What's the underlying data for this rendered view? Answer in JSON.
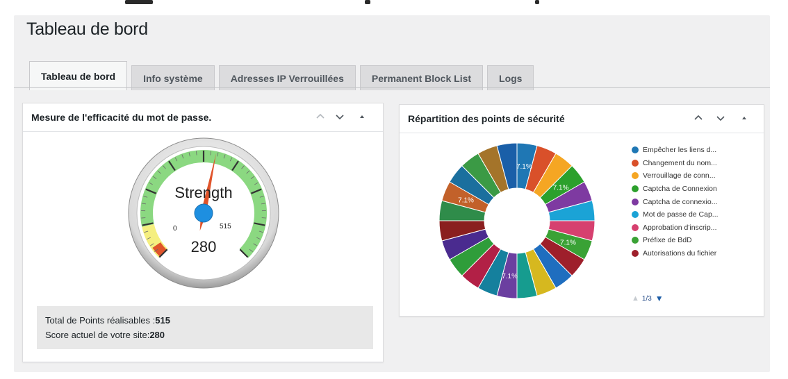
{
  "page": {
    "title": "Tableau de bord"
  },
  "tabs": [
    {
      "label": "Tableau de bord",
      "active": true
    },
    {
      "label": "Info système"
    },
    {
      "label": "Adresses IP Verrouillées"
    },
    {
      "label": "Permanent Block List"
    },
    {
      "label": "Logs"
    }
  ],
  "password_panel": {
    "title": "Mesure de l'efficacité du mot de passe.",
    "gauge": {
      "label": "Strength",
      "min_label": "0",
      "max_label": "515",
      "value_label": "280",
      "value": 280,
      "max": 515
    },
    "total_label": "Total de Points réalisables :",
    "total_value": "515",
    "current_label": "Score actuel de votre site:",
    "current_value": "280"
  },
  "security_panel": {
    "title": "Répartition des points de sécurité",
    "legend": [
      {
        "label": "Empêcher les liens d...",
        "color": "#1f77b4"
      },
      {
        "label": "Changement du nom...",
        "color": "#d9502a"
      },
      {
        "label": "Verrouillage de conn...",
        "color": "#f5a623"
      },
      {
        "label": "Captcha de Connexion",
        "color": "#2ca02c"
      },
      {
        "label": "Captcha de connexio...",
        "color": "#7e3aa1"
      },
      {
        "label": "Mot de passe de Cap...",
        "color": "#1ba3d6"
      },
      {
        "label": "Approbation d'inscrip...",
        "color": "#d6406f"
      },
      {
        "label": "Préfixe de BdD",
        "color": "#3aa235"
      },
      {
        "label": "Autorisations du fichier",
        "color": "#9e1f2b"
      }
    ],
    "pager": "1/3",
    "pie_labels": [
      "7.1%",
      "7.1%",
      "7.1%",
      "7.1%",
      "7.1%"
    ]
  },
  "colors": {
    "gauge_green": "#8bd881",
    "gauge_yellow": "#f5ef80",
    "gauge_red": "#e0542b",
    "needle_hub": "#1e8fe0"
  }
}
